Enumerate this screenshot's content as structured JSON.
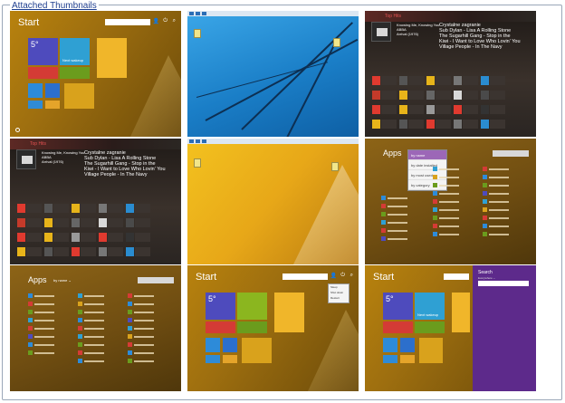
{
  "legend": "Attached Thumbnails",
  "start": {
    "title": "Start",
    "weather_temp": "5°",
    "clock_label": "Next wakeup"
  },
  "music": {
    "breadcrumb": "Top Hits",
    "album_caption": "ABBA ARRIVAL",
    "title_lines": "Knowing Me, Knowing You\nABBA\nArrival (1976)",
    "lyric_lines": "Crystalne zagranie\nSub Dylan - Lisa A Rolling Stone\nThe Sugarhill Gang - Stop in the\nKiwi - I Want to Love Who Lovin' You\nVillage People - In The Navy"
  },
  "apps": {
    "title": "Apps",
    "sort_label": "by name ⌄",
    "sort_options": [
      "by name",
      "by date installed",
      "by most used",
      "by category"
    ],
    "selected_sort": "by name"
  },
  "power_menu": [
    "Sleep",
    "Shut down",
    "Restart"
  ],
  "search_pane": {
    "title": "Search",
    "scope": "Everywhere ⌄"
  },
  "tile_colors": {
    "weather": "#4e4bbd",
    "clock": "#2fa0d3",
    "photos": "#8bb61f",
    "accent_purple": "#5d2a8b"
  }
}
